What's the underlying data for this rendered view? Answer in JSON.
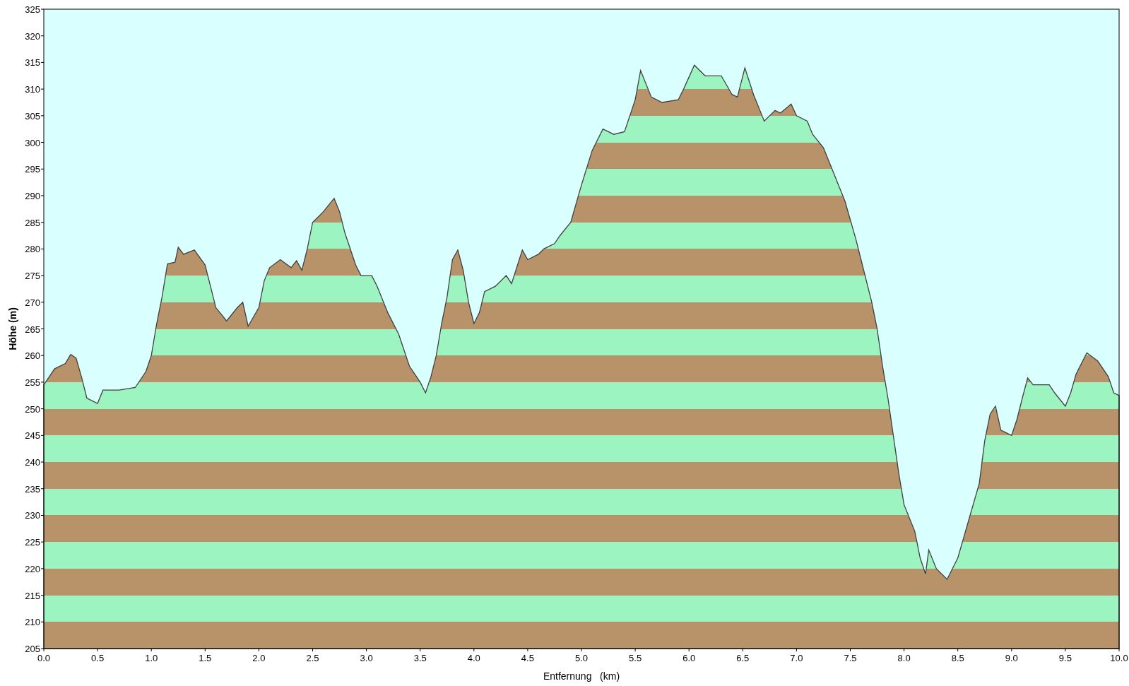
{
  "chart_data": {
    "type": "area",
    "xlabel": "Entfernung   (km)",
    "ylabel": "Höhe (m)",
    "x": [
      0,
      0.1,
      0.2,
      0.25,
      0.3,
      0.35,
      0.4,
      0.5,
      0.55,
      0.7,
      0.85,
      0.95,
      1.0,
      1.05,
      1.1,
      1.15,
      1.22,
      1.25,
      1.3,
      1.4,
      1.5,
      1.55,
      1.6,
      1.7,
      1.8,
      1.85,
      1.9,
      2.0,
      2.05,
      2.1,
      2.2,
      2.3,
      2.35,
      2.4,
      2.45,
      2.5,
      2.6,
      2.7,
      2.75,
      2.8,
      2.9,
      2.95,
      3.05,
      3.1,
      3.2,
      3.3,
      3.4,
      3.5,
      3.55,
      3.6,
      3.65,
      3.7,
      3.75,
      3.8,
      3.85,
      3.9,
      3.95,
      4.0,
      4.05,
      4.1,
      4.2,
      4.3,
      4.35,
      4.45,
      4.5,
      4.6,
      4.65,
      4.75,
      4.8,
      4.9,
      5.0,
      5.1,
      5.2,
      5.3,
      5.4,
      5.5,
      5.55,
      5.65,
      5.75,
      5.9,
      5.95,
      6.05,
      6.15,
      6.3,
      6.4,
      6.45,
      6.52,
      6.6,
      6.7,
      6.8,
      6.85,
      6.95,
      7.0,
      7.1,
      7.15,
      7.25,
      7.35,
      7.45,
      7.55,
      7.6,
      7.7,
      7.75,
      7.8,
      7.85,
      7.9,
      7.95,
      8.0,
      8.1,
      8.15,
      8.2,
      8.23,
      8.3,
      8.4,
      8.5,
      8.6,
      8.7,
      8.75,
      8.8,
      8.85,
      8.9,
      8.95,
      9.0,
      9.05,
      9.1,
      9.15,
      9.2,
      9.35,
      9.4,
      9.5,
      9.55,
      9.6,
      9.7,
      9.8,
      9.9,
      9.95,
      10.0
    ],
    "series": [
      {
        "color": "#404040",
        "values": [
          254.5,
          257.5,
          258.5,
          260.2,
          259.5,
          256,
          252,
          251,
          253.5,
          253.5,
          254,
          257,
          260,
          266,
          271,
          277.2,
          277.5,
          280.3,
          279,
          279.8,
          277,
          273,
          269,
          266.5,
          269,
          270,
          265.5,
          269,
          274,
          276.5,
          278,
          276.5,
          277.8,
          276,
          280,
          285,
          287,
          289.5,
          287,
          283,
          277,
          275,
          275,
          273,
          268,
          264,
          258,
          255,
          253,
          256,
          260,
          266,
          271,
          278,
          279.8,
          276,
          270,
          266,
          268,
          272,
          273,
          275,
          273.5,
          279.8,
          278,
          279,
          280,
          281,
          282.5,
          285,
          292,
          298.5,
          302.5,
          301.5,
          302,
          308,
          313.5,
          308.5,
          307.5,
          308,
          310,
          314.5,
          312.5,
          312.5,
          309,
          308.5,
          314,
          309,
          304,
          306,
          305.5,
          307.2,
          305,
          304,
          301.5,
          299,
          294,
          289,
          282,
          278,
          270,
          265,
          258,
          252,
          245,
          238,
          232,
          227,
          222,
          219,
          223.5,
          220,
          218,
          222,
          229,
          236,
          244,
          249,
          250.5,
          246,
          245.5,
          245,
          248,
          252,
          255.8,
          254.5,
          254.5,
          253,
          250.5,
          253,
          256.5,
          260.5,
          259,
          256,
          253,
          252.5
        ]
      }
    ],
    "xlim": [
      0,
      10
    ],
    "ylim": [
      205,
      325
    ],
    "xticks": [
      {
        "value": 0,
        "label": "0.0"
      },
      {
        "value": 0.5,
        "label": "0.5"
      },
      {
        "value": 1,
        "label": "1.0"
      },
      {
        "value": 1.5,
        "label": "1.5"
      },
      {
        "value": 2,
        "label": "2.0"
      },
      {
        "value": 2.5,
        "label": "2.5"
      },
      {
        "value": 3,
        "label": "3.0"
      },
      {
        "value": 3.5,
        "label": "3.5"
      },
      {
        "value": 4,
        "label": "4.0"
      },
      {
        "value": 4.5,
        "label": "4.5"
      },
      {
        "value": 5,
        "label": "5.0"
      },
      {
        "value": 5.5,
        "label": "5.5"
      },
      {
        "value": 6,
        "label": "6.0"
      },
      {
        "value": 6.5,
        "label": "6.5"
      },
      {
        "value": 7,
        "label": "7.0"
      },
      {
        "value": 7.5,
        "label": "7.5"
      },
      {
        "value": 8,
        "label": "8.0"
      },
      {
        "value": 8.5,
        "label": "8.5"
      },
      {
        "value": 9,
        "label": "9.0"
      },
      {
        "value": 9.5,
        "label": "9.5"
      },
      {
        "value": 10,
        "label": "10.0"
      }
    ],
    "yticks": [
      205,
      210,
      215,
      220,
      225,
      230,
      235,
      240,
      245,
      250,
      255,
      260,
      265,
      270,
      275,
      280,
      285,
      290,
      295,
      300,
      305,
      310,
      315,
      320,
      325
    ]
  }
}
